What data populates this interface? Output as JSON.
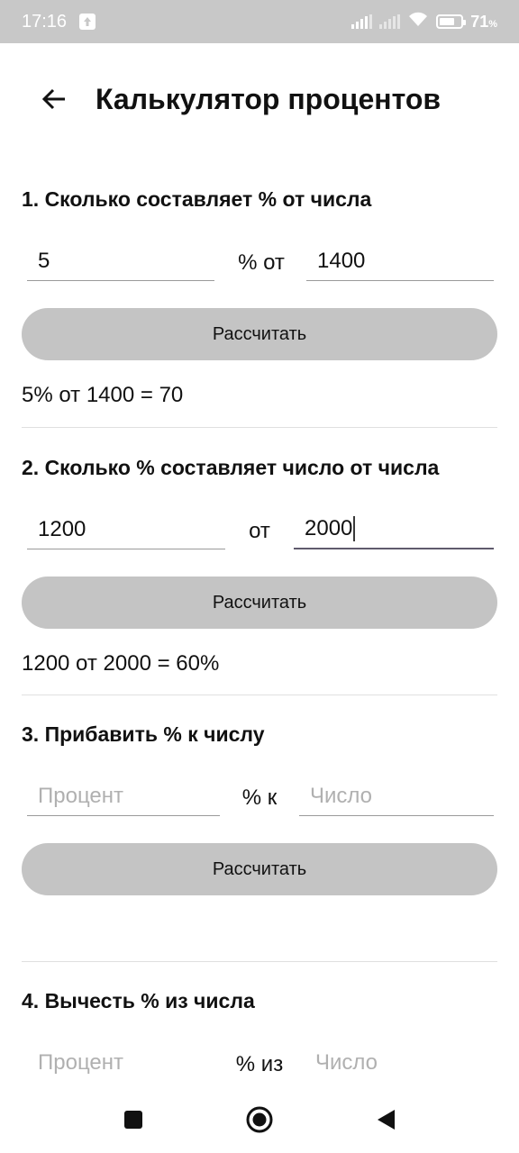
{
  "status_bar": {
    "time": "17:16",
    "battery_percent": "71",
    "battery_level": 0.71
  },
  "header": {
    "title": "Калькулятор процентов"
  },
  "sections": [
    {
      "title": "1. Сколько составляет % от числа",
      "field_a": {
        "value": "5",
        "placeholder": ""
      },
      "middle_label": "% от",
      "field_b": {
        "value": "1400",
        "placeholder": ""
      },
      "button_label": "Рассчитать",
      "result": "5% от 1400 = 70"
    },
    {
      "title": "2. Сколько % составляет число от числа",
      "field_a": {
        "value": "1200",
        "placeholder": ""
      },
      "middle_label": "от",
      "field_b": {
        "value": "2000",
        "placeholder": ""
      },
      "button_label": "Рассчитать",
      "result": "1200 от 2000 = 60%"
    },
    {
      "title": "3. Прибавить % к числу",
      "field_a": {
        "value": "",
        "placeholder": "Процент"
      },
      "middle_label": "% к",
      "field_b": {
        "value": "",
        "placeholder": "Число"
      },
      "button_label": "Рассчитать",
      "result": ""
    },
    {
      "title": "4. Вычесть % из числа",
      "field_a": {
        "value": "",
        "placeholder": "Процент"
      },
      "middle_label": "% из",
      "field_b": {
        "value": "",
        "placeholder": "Число"
      }
    }
  ],
  "nav_bar": {
    "icons": [
      "recents-square-icon",
      "home-circle-icon",
      "back-triangle-icon"
    ]
  },
  "colors": {
    "status_bar_bg": "#c8c8c8",
    "button_bg": "#c4c4c4",
    "focus_underline": "#5f5a6d",
    "placeholder": "#b0b0b0"
  }
}
